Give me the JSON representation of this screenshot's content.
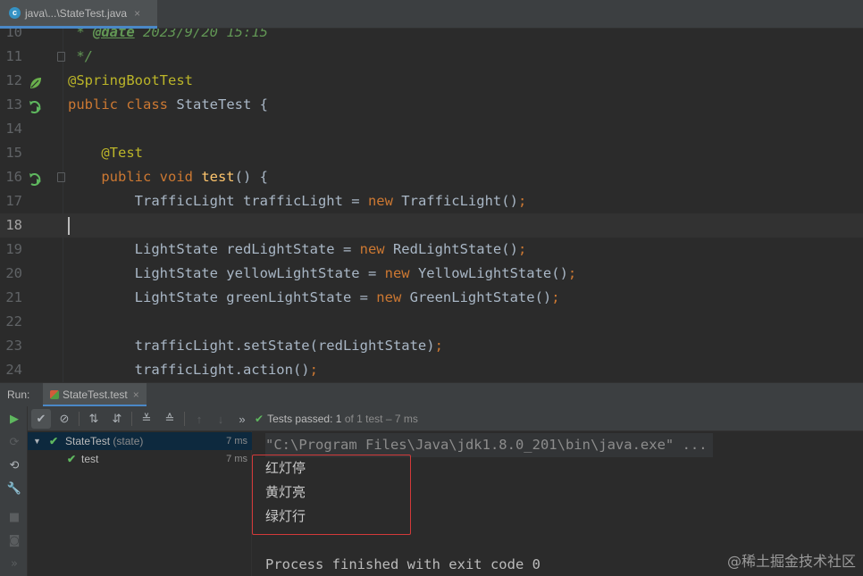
{
  "editor_tab": {
    "icon": "c",
    "label": "java\\...\\StateTest.java",
    "close": "×"
  },
  "code": [
    {
      "num": "10",
      "tokens": [
        {
          "t": " * ",
          "c": "cm"
        },
        {
          "t": "@date",
          "c": "cmtag"
        },
        {
          "t": " 2023/9/20 15:15",
          "c": "cm"
        }
      ]
    },
    {
      "num": "11",
      "tokens": [
        {
          "t": " */",
          "c": "cm"
        }
      ],
      "fold": true
    },
    {
      "num": "12",
      "tokens": [
        {
          "t": "@SpringBootTest",
          "c": "ann"
        }
      ],
      "gutter": "leaf-icon"
    },
    {
      "num": "13",
      "tokens": [
        {
          "t": "public class ",
          "c": "kw"
        },
        {
          "t": "StateTest {",
          "c": ""
        }
      ],
      "gutter": "run-test-icon"
    },
    {
      "num": "14",
      "tokens": []
    },
    {
      "num": "15",
      "tokens": [
        {
          "t": "    "
        },
        {
          "t": "@Test",
          "c": "ann"
        }
      ]
    },
    {
      "num": "16",
      "tokens": [
        {
          "t": "    "
        },
        {
          "t": "public void ",
          "c": "kw"
        },
        {
          "t": "test",
          "c": "fn"
        },
        {
          "t": "() {",
          "c": ""
        }
      ],
      "gutter": "run-test-icon",
      "fold": true
    },
    {
      "num": "17",
      "tokens": [
        {
          "t": "        TrafficLight trafficLight = "
        },
        {
          "t": "new ",
          "c": "kw"
        },
        {
          "t": "TrafficLight()"
        },
        {
          "t": ";",
          "c": "kw"
        }
      ]
    },
    {
      "num": "18",
      "tokens": [],
      "current": true
    },
    {
      "num": "19",
      "tokens": [
        {
          "t": "        LightState redLightState = "
        },
        {
          "t": "new ",
          "c": "kw"
        },
        {
          "t": "RedLightState()"
        },
        {
          "t": ";",
          "c": "kw"
        }
      ]
    },
    {
      "num": "20",
      "tokens": [
        {
          "t": "        LightState yellowLightState = "
        },
        {
          "t": "new ",
          "c": "kw"
        },
        {
          "t": "YellowLightState()"
        },
        {
          "t": ";",
          "c": "kw"
        }
      ]
    },
    {
      "num": "21",
      "tokens": [
        {
          "t": "        LightState greenLightState = "
        },
        {
          "t": "new ",
          "c": "kw"
        },
        {
          "t": "GreenLightState()"
        },
        {
          "t": ";",
          "c": "kw"
        }
      ]
    },
    {
      "num": "22",
      "tokens": []
    },
    {
      "num": "23",
      "tokens": [
        {
          "t": "        trafficLight.setState(redLightState)"
        },
        {
          "t": ";",
          "c": "kw"
        }
      ]
    },
    {
      "num": "24",
      "tokens": [
        {
          "t": "        trafficLight.action()"
        },
        {
          "t": ";",
          "c": "kw"
        }
      ]
    }
  ],
  "run_panel": {
    "label": "Run:",
    "tab_label": "StateTest.test",
    "tab_close": "×",
    "status_prefix": "Tests passed:",
    "status_count": "1",
    "status_suffix": "of 1 test – 7 ms",
    "tree": [
      {
        "label": "StateTest",
        "sub": "(state)",
        "time": "7 ms",
        "selected": true
      },
      {
        "label": "test",
        "sub": "",
        "time": "7 ms",
        "selected": false
      }
    ],
    "console": {
      "command": "\"C:\\Program Files\\Java\\jdk1.8.0_201\\bin\\java.exe\" ...",
      "output": [
        "红灯停",
        "黄灯亮",
        "绿灯行"
      ],
      "finish": "Process finished with exit code 0"
    }
  },
  "watermark": "@稀土掘金技术社区",
  "colors": {
    "keyword": "#cc7832",
    "annotation": "#bbb529",
    "method": "#ffc66d",
    "comment": "#629755",
    "pass": "#5fb85f",
    "highlight_box": "#d33a3a"
  }
}
